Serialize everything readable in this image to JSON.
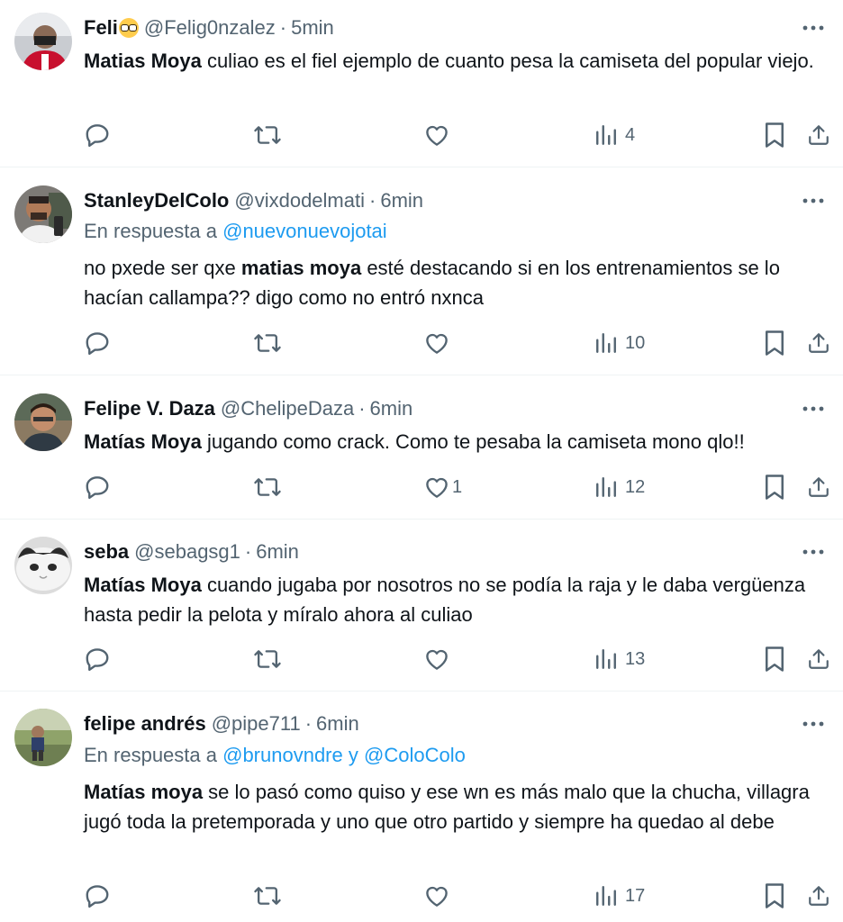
{
  "tweets": [
    {
      "name": "Feli",
      "has_emoji": true,
      "emoji_icon": "nerd-face-emoji",
      "handle": "@Felig0nzalez",
      "dot": "·",
      "time": "5min",
      "reply_prefix": "",
      "reply_mentions": [],
      "text_bold": "Matias Moya",
      "text_rest": " culiao es el fiel ejemplo de cuanto pesa la camiseta del popular viejo.",
      "likes": "",
      "views": "4"
    },
    {
      "name": "StanleyDelColo",
      "has_emoji": false,
      "handle": "@vixdodelmati",
      "dot": "·",
      "time": "6min",
      "reply_prefix": "En respuesta a",
      "reply_mentions": [
        "@nuevonuevojotai"
      ],
      "text_pre": "no pxede ser qxe ",
      "text_bold": "matias moya",
      "text_rest": " esté destacando si en los entrenamientos se lo hacían callampa?? digo como no entró nxnca",
      "likes": "",
      "views": "10"
    },
    {
      "name": "Felipe V. Daza",
      "has_emoji": false,
      "handle": "@ChelipeDaza",
      "dot": "·",
      "time": "6min",
      "reply_prefix": "",
      "reply_mentions": [],
      "text_bold": "Matías Moya",
      "text_rest": " jugando como crack. Como te pesaba la camiseta mono qlo!!",
      "likes": "1",
      "views": "12"
    },
    {
      "name": "seba",
      "has_emoji": false,
      "handle": "@sebagsg1",
      "dot": "·",
      "time": "6min",
      "reply_prefix": "",
      "reply_mentions": [],
      "text_bold": "Matías Moya",
      "text_rest": " cuando jugaba por nosotros no se podía la raja y le daba vergüenza hasta pedir la pelota y míralo ahora al culiao",
      "likes": "",
      "views": "13"
    },
    {
      "name": "felipe andrés",
      "has_emoji": false,
      "handle": "@pipe711",
      "dot": "·",
      "time": "6min",
      "reply_prefix": "En respuesta a",
      "reply_mentions": [
        "@brunovndre",
        "@ColoColo"
      ],
      "reply_joiner": "y",
      "text_bold": "Matías moya",
      "text_rest": " se lo pasó como quiso y ese wn es más malo que la chucha, villagra jugó toda la pretemporada y uno que otro partido y siempre ha quedao al debe",
      "likes": "",
      "views": "17"
    }
  ],
  "icons": {
    "reply": "reply-icon",
    "retweet": "retweet-icon",
    "like": "heart-icon",
    "views": "views-icon",
    "bookmark": "bookmark-icon",
    "share": "share-icon",
    "more": "more-icon"
  },
  "colors": {
    "text": "#0f1419",
    "secondary": "#536471",
    "link": "#1d9bf0",
    "divider": "#eff3f4"
  }
}
